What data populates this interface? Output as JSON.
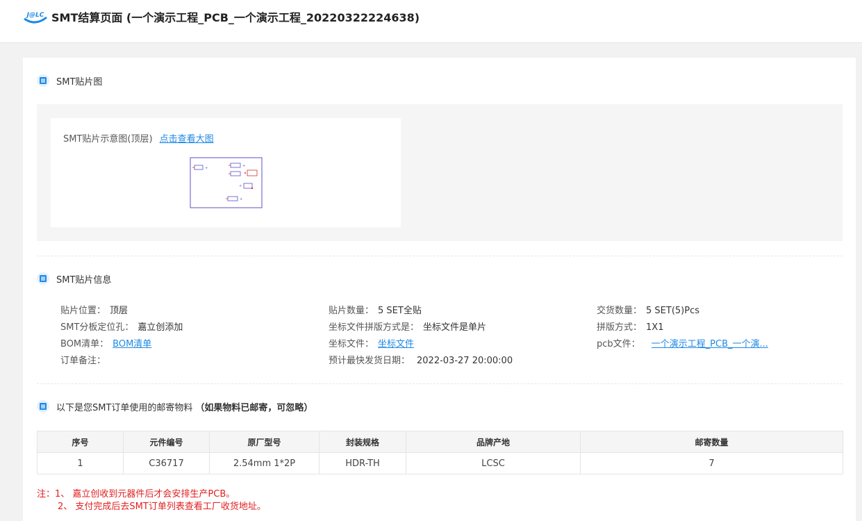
{
  "header": {
    "logo_text": "J@LC",
    "title": "SMT结算页面 (一个演示工程_PCB_一个演示工程_20220322224638)"
  },
  "placement_map": {
    "section_title": "SMT贴片图",
    "caption": "SMT贴片示意图(顶层)",
    "view_large_link": "点击查看大图"
  },
  "info": {
    "section_title": "SMT贴片信息",
    "rows": [
      [
        {
          "label": "贴片位置：",
          "value": "顶层"
        },
        {
          "label": "贴片数量：",
          "value": "5 SET全贴"
        },
        {
          "label": "交货数量：",
          "value": "5 SET(5)Pcs"
        }
      ],
      [
        {
          "label": "SMT分板定位孔：",
          "value": "嘉立创添加"
        },
        {
          "label": "坐标文件拼版方式是：",
          "value": "坐标文件是单片"
        },
        {
          "label": "拼版方式：",
          "value": "1X1"
        }
      ],
      [
        {
          "label": "BOM清单：",
          "link": "BOM清单"
        },
        {
          "label": "坐标文件：",
          "link": "坐标文件"
        },
        {
          "label": "pcb文件：",
          "link": "一个演示工程_PCB_一个演..."
        }
      ],
      [
        {
          "label": "订单备注：",
          "value": ""
        },
        {
          "label": "预计最快发货日期：",
          "value": "2022-03-27 20:00:00"
        }
      ]
    ]
  },
  "materials": {
    "section_title": "以下是您SMT订单使用的邮寄物料",
    "section_note": "（如果物料已邮寄，可忽略）",
    "columns": [
      "序号",
      "元件编号",
      "原厂型号",
      "封装规格",
      "品牌产地",
      "邮寄数量"
    ],
    "rows": [
      [
        "1",
        "C36717",
        "2.54mm 1*2P",
        "HDR-TH",
        "LCSC",
        "7"
      ]
    ]
  },
  "notes": {
    "line1": "注：1、 嘉立创收到元器件后才会安排生产PCB。",
    "line2": "2、 支付完成后去SMT订单列表查看工厂收货地址。"
  },
  "colors": {
    "accent": "#1e88e5",
    "note_red": "#e02020",
    "pcb_outline": "#5b4fc9"
  }
}
